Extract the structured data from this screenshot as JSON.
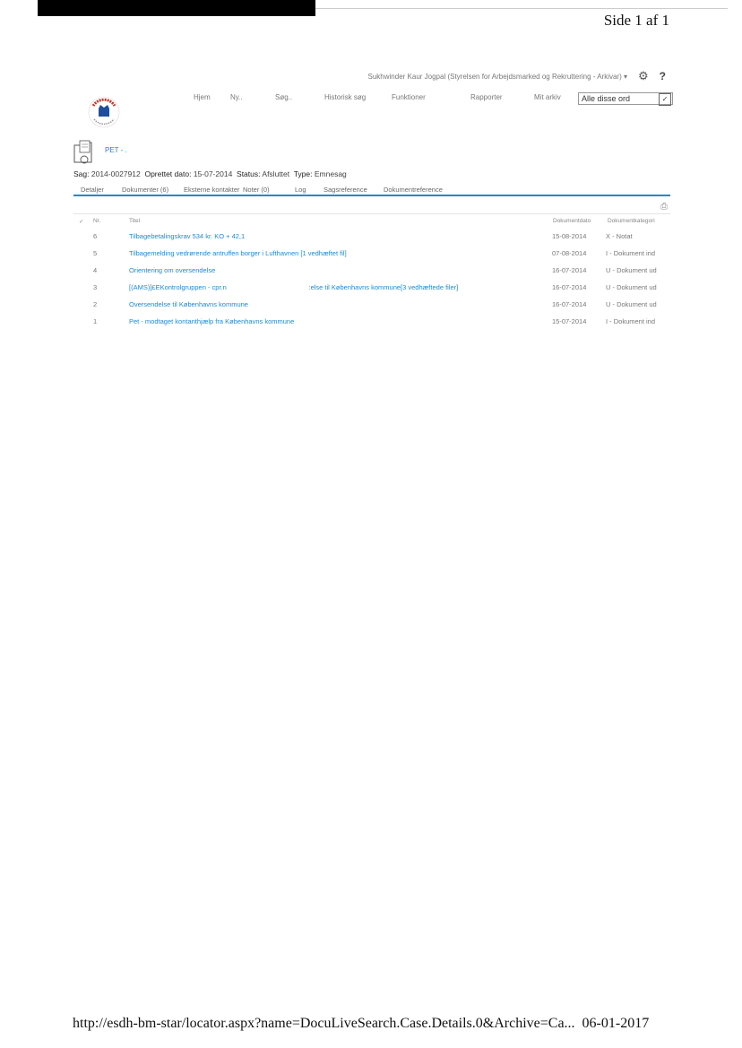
{
  "page": {
    "page_number": "Side 1 af 1"
  },
  "user_bar": {
    "user": "Sukhwinder Kaur Jogpal (Styrelsen for Arbejdsmarked og Rekruttering - Arkivar)",
    "dropdown_arrow": "▾",
    "settings_icon": "gear-icon",
    "help_label": "?"
  },
  "nav": {
    "items": [
      "Hjem",
      "Ny..",
      "Søg..",
      "Historisk søg",
      "Funktioner",
      "Rapporter",
      "Mit arkiv"
    ],
    "search_mode": "Alle disse ord",
    "search_arrow": "✓"
  },
  "case": {
    "name": "PET - .",
    "sag_label": "Sag:",
    "sag_value": "2014-0027912",
    "oprettet_label": "Oprettet dato:",
    "oprettet_value": "15-07-2014",
    "status_label": "Status:",
    "status_value": "Afsluttet",
    "type_label": "Type:",
    "type_value": "Emnesag"
  },
  "tabs": [
    "Detaljer",
    "Dokumenter (6)",
    "Eksterne kontakter",
    "Noter (0)",
    "Log",
    "Sagsreference",
    "Dokumentreference"
  ],
  "table": {
    "check_header": "✓",
    "headers": {
      "nr": "Nr.",
      "title": "Titel",
      "date": "Dokumentdato",
      "category": "Dokumentkategori"
    },
    "rows": [
      {
        "nr": "6",
        "title": "Tilbagebetalingskrav 534 kr. KO + 42,1",
        "date": "15-08-2014",
        "category": "X - Notat"
      },
      {
        "nr": "5",
        "title": "Tilbagemelding vedrørende antruffen borger i Lufthavnen [1 vedhæftet fil]",
        "date": "07-08-2014",
        "category": "I - Dokument ind"
      },
      {
        "nr": "4",
        "title": "Orientering om oversendelse",
        "date": "16-07-2014",
        "category": "U - Dokument ud"
      },
      {
        "nr": "3",
        "title": "[(AMS)]£EKontrolgruppen - cpr.n                                            :else til Københavns kommune[3 vedhæftede filer]",
        "date": "16-07-2014",
        "category": "U - Dokument ud"
      },
      {
        "nr": "2",
        "title": "Oversendelse til Københavns kommune",
        "date": "16-07-2014",
        "category": "U - Dokument ud"
      },
      {
        "nr": "1",
        "title": "Pet - modtaget kontanthjælp fra Københavns kommune",
        "date": "15-07-2014",
        "category": "I - Dokument ind"
      }
    ]
  },
  "footer": {
    "url": "http://esdh-bm-star/locator.aspx?name=DocuLiveSearch.Case.Details.0&Archive=Ca...",
    "date": "06-01-2017"
  },
  "colors": {
    "link": "#1a8ad6",
    "tab_line": "#2a86c8",
    "logo_red": "#c0392b",
    "logo_blue": "#1f4f9c"
  }
}
